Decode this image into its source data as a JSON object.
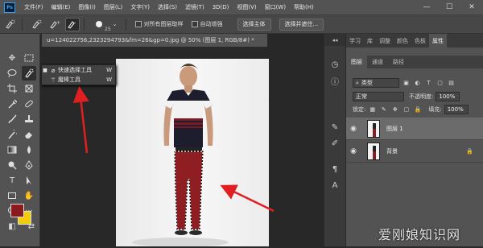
{
  "app": {
    "logo_text": "Ps"
  },
  "menubar": {
    "items": [
      "文件(F)",
      "编辑(E)",
      "图像(I)",
      "图层(L)",
      "文字(Y)",
      "选择(S)",
      "滤镜(T)",
      "3D(D)",
      "视图(V)",
      "窗口(W)",
      "帮助(H)"
    ],
    "window_controls": [
      "—",
      "☐",
      "✕"
    ]
  },
  "options_bar": {
    "brush_size": "25",
    "sample_all_layers_label": "对所有图层取样",
    "auto_enhance_label": "自动增强",
    "select_subject_label": "选择主体",
    "select_and_mask_label": "选择并遮住..."
  },
  "document": {
    "tab_title": "u=124022756,2323294793&fm=26&gp=0.jpg @ 50% (图层 1, RGB/8#) *"
  },
  "tool_flyout": {
    "items": [
      {
        "label": "快速选择工具",
        "shortcut": "W",
        "active": true
      },
      {
        "label": "魔棒工具",
        "shortcut": "W",
        "active": false
      }
    ]
  },
  "colors": {
    "foreground": "#8a1a1e",
    "background": "#f2cd07",
    "accent_arrow": "#e02020"
  },
  "mid_strip": {
    "collapse_label": "◂◂"
  },
  "panel_tabs": {
    "items": [
      "学习",
      "库",
      "调整",
      "颜色",
      "色板",
      "属性"
    ],
    "active": "属性"
  },
  "layers_panel": {
    "tabs": [
      "图层",
      "通道",
      "路径"
    ],
    "filter_label": "类型",
    "blend_mode": "正常",
    "opacity_label": "不透明度:",
    "opacity_value": "100%",
    "lock_label": "锁定:",
    "fill_label": "填充:",
    "fill_value": "100%",
    "layers": [
      {
        "name": "图层 1",
        "selected": true,
        "locked": false
      },
      {
        "name": "背景",
        "selected": false,
        "locked": true
      }
    ]
  },
  "watermark": {
    "text": "爱刚娘知识网"
  }
}
